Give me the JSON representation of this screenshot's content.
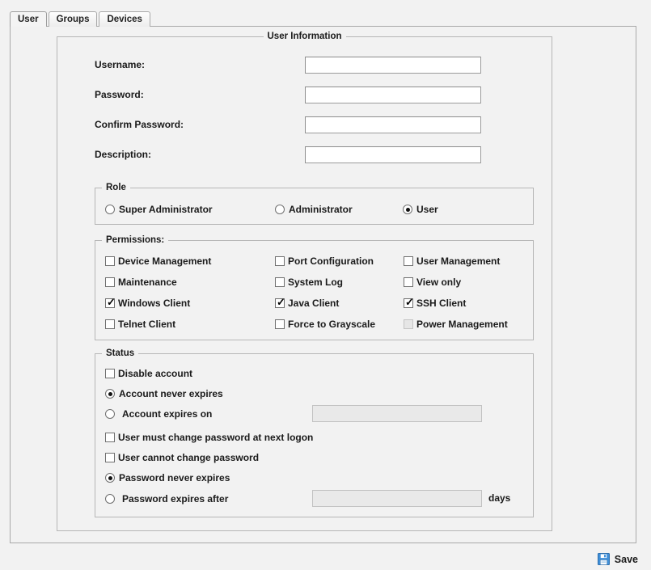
{
  "tabs": [
    {
      "label": "User",
      "active": true
    },
    {
      "label": "Groups",
      "active": false
    },
    {
      "label": "Devices",
      "active": false
    }
  ],
  "user_information": {
    "legend": "User Information",
    "fields": [
      {
        "label": "Username:",
        "value": "",
        "placeholder": ""
      },
      {
        "label": "Password:",
        "value": "",
        "placeholder": ""
      },
      {
        "label": "Confirm Password:",
        "value": "",
        "placeholder": ""
      },
      {
        "label": "Description:",
        "value": "",
        "placeholder": ""
      }
    ]
  },
  "role": {
    "legend": "Role",
    "options": [
      {
        "label": "Super Administrator",
        "selected": false
      },
      {
        "label": "Administrator",
        "selected": false
      },
      {
        "label": "User",
        "selected": true
      }
    ]
  },
  "permissions": {
    "legend": "Permissions:",
    "items": [
      {
        "label": "Device Management",
        "checked": false,
        "disabled": false
      },
      {
        "label": "Port Configuration",
        "checked": false,
        "disabled": false
      },
      {
        "label": "User Management",
        "checked": false,
        "disabled": false
      },
      {
        "label": "Maintenance",
        "checked": false,
        "disabled": false
      },
      {
        "label": "System Log",
        "checked": false,
        "disabled": false
      },
      {
        "label": "View only",
        "checked": false,
        "disabled": false
      },
      {
        "label": "Windows Client",
        "checked": true,
        "disabled": false
      },
      {
        "label": "Java Client",
        "checked": true,
        "disabled": false
      },
      {
        "label": "SSH Client",
        "checked": true,
        "disabled": false
      },
      {
        "label": "Telnet Client",
        "checked": false,
        "disabled": false
      },
      {
        "label": "Force to Grayscale",
        "checked": false,
        "disabled": false
      },
      {
        "label": "Power Management",
        "checked": false,
        "disabled": true
      }
    ]
  },
  "status": {
    "legend": "Status",
    "disable_account": {
      "label": "Disable account",
      "checked": false
    },
    "account_never_expires": {
      "label": "Account never expires",
      "selected": true
    },
    "account_expires_on": {
      "label": "Account expires on",
      "selected": false,
      "value": "",
      "placeholder": ""
    },
    "must_change_password": {
      "label": "User must change password at next logon",
      "checked": false
    },
    "cannot_change_password": {
      "label": "User cannot change password",
      "checked": false
    },
    "password_never_expires": {
      "label": "Password never expires",
      "selected": true
    },
    "password_expires_after": {
      "label": "Password expires after",
      "selected": false,
      "value": "",
      "placeholder": "",
      "suffix": "days"
    }
  },
  "footer": {
    "save_label": "Save",
    "save_icon": "floppy-disk-icon"
  },
  "colors": {
    "background": "#f2f2f2",
    "border": "#b6b6b6",
    "text": "#1a1a1a",
    "input_background": "#ffffff",
    "input_disabled": "#e9e9e9",
    "save_icon_blue": "#3f8fd8"
  }
}
